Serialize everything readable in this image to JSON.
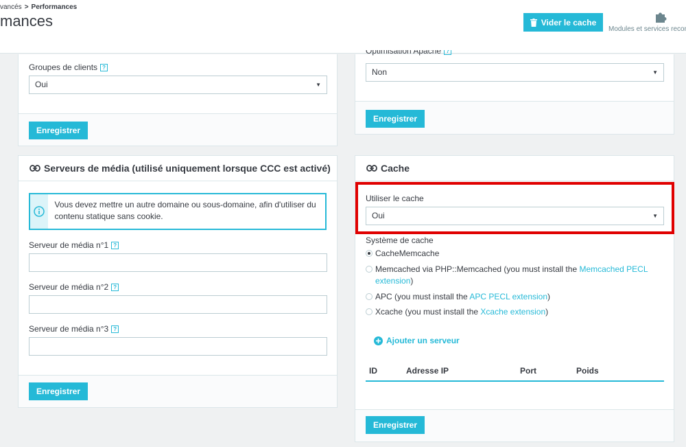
{
  "header": {
    "breadcrumb": {
      "parent": "vancés",
      "separator": ">",
      "current": "Performances"
    },
    "title": "mances",
    "clear_cache_label": "Vider le cache",
    "modules_label": "Modules et services recom"
  },
  "customer_groups_panel": {
    "label": "Groupes de clients",
    "help": "?",
    "selected": "Oui",
    "save_label": "Enregistrer"
  },
  "apache_panel": {
    "label": "Optimisation Apache",
    "help": "?",
    "selected": "Non",
    "save_label": "Enregistrer"
  },
  "media_panel": {
    "title": "Serveurs de média (utilisé uniquement lorsque CCC est activé)",
    "alert": "Vous devez mettre un autre domaine ou sous-domaine, afin d'utiliser du contenu statique sans cookie.",
    "server1_label": "Serveur de média n°1",
    "server2_label": "Serveur de média n°2",
    "server3_label": "Serveur de média n°3",
    "help": "?",
    "server1_value": "",
    "server2_value": "",
    "server3_value": "",
    "save_label": "Enregistrer"
  },
  "cache_panel": {
    "title": "Cache",
    "use_cache_label": "Utiliser le cache",
    "use_cache_selected": "Oui",
    "system_label": "Système de cache",
    "options": {
      "memcache": "CacheMemcache",
      "memcached_pre": "Memcached via PHP::Memcached (you must install the ",
      "memcached_link": "Memcached PECL extension",
      "memcached_post": ")",
      "apc_pre": "APC (you must install the ",
      "apc_link": "APC PECL extension",
      "apc_post": ")",
      "xcache_pre": "Xcache (you must install the ",
      "xcache_link": "Xcache extension",
      "xcache_post": ")"
    },
    "selected_option": "CacheMemcache",
    "add_server_label": "Ajouter un serveur",
    "table_headers": {
      "id": "ID",
      "ip": "Adresse IP",
      "port": "Port",
      "weight": "Poids"
    },
    "save_label": "Enregistrer"
  },
  "colors": {
    "accent": "#25b9d7",
    "highlight": "#e00000",
    "background": "#eff1f2"
  }
}
